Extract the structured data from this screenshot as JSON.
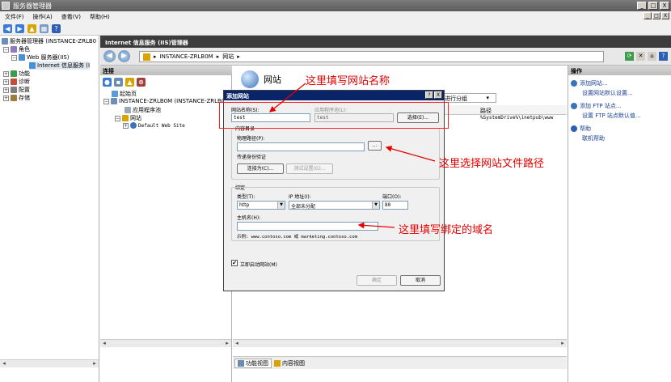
{
  "window": {
    "title": "服务器管理器",
    "menu": [
      "文件(F)",
      "操作(A)",
      "查看(V)",
      "帮助(H)"
    ],
    "controls": {
      "minimize": "_",
      "maximize": "□",
      "close": "X"
    }
  },
  "tree": {
    "root": "服务器管理器 (INSTANCE-ZRLB0",
    "roles": "角色",
    "web_server": "Web 服务器(IIS)",
    "iis_manager": "Internet 信息服务 (I",
    "features": "功能",
    "diagnostics": "诊断",
    "config": "配置",
    "storage": "存储"
  },
  "iis": {
    "header": "Internet 信息服务 (IIS)管理器",
    "address": [
      "INSTANCE-ZRLB0M",
      "网站"
    ],
    "connections_title": "连接",
    "conn_tree": {
      "start_page": "起始页",
      "server": "INSTANCE-ZRLB0M (INSTANCE-ZRLB0M\\",
      "app_pools": "应用程序池",
      "sites": "网站",
      "default_site": "Default Web Site"
    },
    "center_title": "网站",
    "group_by": "进行分组",
    "grid_header_path": "路径",
    "grid_row_path": "%SystemDrive%\\inetpub\\www",
    "tabs": {
      "features_view": "功能视图",
      "content_view": "内容视图"
    },
    "actions_title": "操作",
    "actions": {
      "add_site": "添加网站...",
      "site_defaults": "设置网站默认设置...",
      "add_ftp": "添加 FTP 站点...",
      "ftp_defaults": "设置 FTP 站点默认值...",
      "help": "帮助",
      "online_help": "联机帮助"
    }
  },
  "dialog": {
    "title": "添加网站",
    "help_btn": "?",
    "close_btn": "X",
    "site_name_label": "网站名称(S):",
    "site_name_value": "test",
    "app_pool_label": "应用程序池(L):",
    "app_pool_value": "test",
    "select_btn": "选择(E)...",
    "content_dir_label": "内容目录",
    "physical_path_label": "物理路径(P):",
    "physical_path_value": "",
    "browse_btn": "...",
    "passthrough_label": "传递身份验证",
    "connect_as_btn": "连接为(C)...",
    "test_settings_btn": "测试设置(G)...",
    "binding_label": "绑定",
    "type_label": "类型(T):",
    "type_value": "http",
    "ip_label": "IP 地址(I):",
    "ip_value": "全部未分配",
    "port_label": "端口(O):",
    "port_value": "80",
    "hostname_label": "主机名(H):",
    "hostname_value": "",
    "example_text": "示例: www.contoso.com 或 marketing.contoso.com",
    "start_now_label": "立即启动网站(M)",
    "start_now_checked": "✔",
    "ok_btn": "确定",
    "cancel_btn": "取消"
  },
  "annotations": {
    "site_name": "这里填写网站名称",
    "path": "这里选择网站文件路径",
    "hostname": "这里填写绑定的域名",
    "color": "#e60000"
  }
}
